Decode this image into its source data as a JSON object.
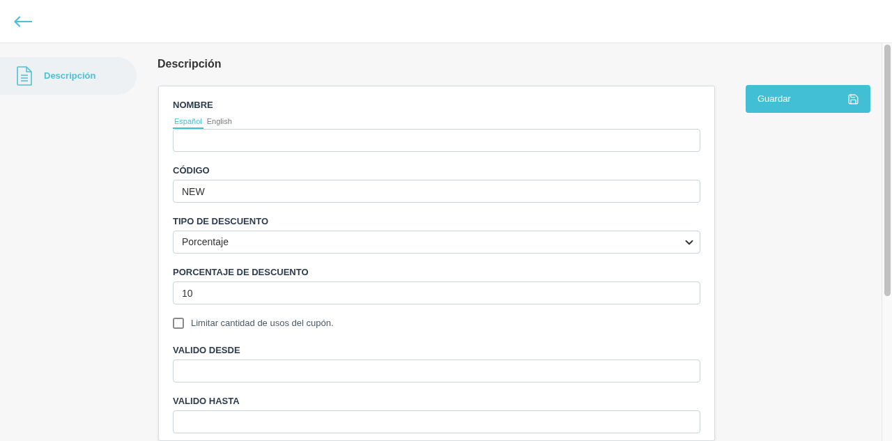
{
  "sidebar": {
    "items": [
      {
        "label": "Descripción",
        "selected": true
      }
    ]
  },
  "content": {
    "title": "Descripción",
    "fields": [
      {
        "kind": "text",
        "label": "NOMBRE",
        "tabs": [
          {
            "label": "Español",
            "selected": true
          },
          {
            "label": "English",
            "selected": false
          }
        ]
      },
      {
        "kind": "text",
        "label": "CÓDIGO",
        "value": "NEW"
      },
      {
        "kind": "select",
        "label": "TIPO DE DESCUENTO",
        "value": "Porcentaje"
      },
      {
        "kind": "text",
        "label": "PORCENTAJE DE DESCUENTO",
        "value": "10"
      },
      {
        "kind": "checkbox",
        "label": "Limitar cantidad de usos del cupón.",
        "checked": false
      },
      {
        "kind": "text",
        "label": "VALIDO DESDE"
      },
      {
        "kind": "text",
        "label": "VALIDO HASTA"
      }
    ]
  },
  "save_button": {
    "label": "Guardar"
  }
}
